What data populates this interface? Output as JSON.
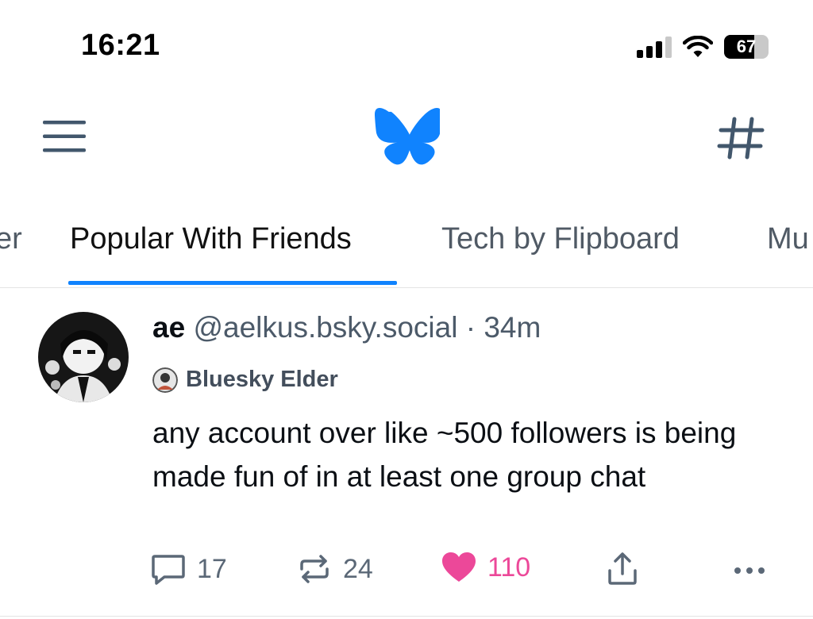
{
  "status_bar": {
    "time": "16:21",
    "battery": "67",
    "battery_level": 0.67,
    "signal_bars_active": 3,
    "signal_bars_total": 4
  },
  "header": {
    "menu_icon": "hamburger-menu-icon",
    "logo_icon": "bluesky-butterfly-icon",
    "feeds_icon": "hashtag-icon",
    "brand_color": "#1083fe"
  },
  "tabs": [
    {
      "label": "er",
      "active": false
    },
    {
      "label": "Popular With Friends",
      "active": true
    },
    {
      "label": "Tech by Flipboard",
      "active": false
    },
    {
      "label": "Mu",
      "active": false
    }
  ],
  "post": {
    "author": "ae",
    "handle": "@aelkus.bsky.social",
    "separator": "·",
    "time": "34m",
    "badge": "Bluesky Elder",
    "text": "any account over like ~500 followers is being made fun of in at least one group chat",
    "actions": {
      "replies": "17",
      "reposts": "24",
      "likes": "110",
      "liked": true,
      "like_color": "#ec4899"
    }
  }
}
